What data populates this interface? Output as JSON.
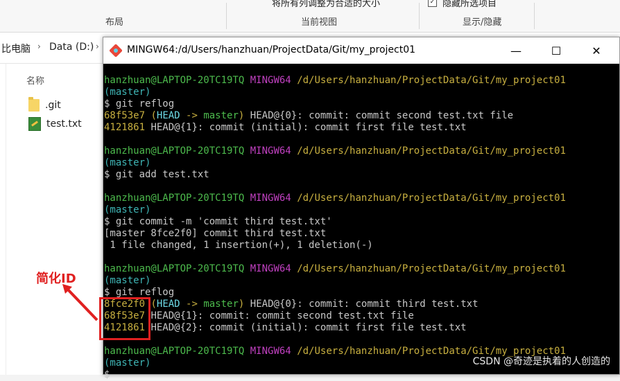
{
  "explorer": {
    "ribbon_clipped": [
      "将所有列调整为合适的大小",
      "隐藏所选项目"
    ],
    "groups": [
      "布局",
      "当前视图",
      "显示/隐藏"
    ],
    "breadcrumb": [
      "比电脑",
      "Data (D:)"
    ],
    "column_header": "名称",
    "files": [
      {
        "name": ".git",
        "icon": "folder-icon"
      },
      {
        "name": "test.txt",
        "icon": "text-file-icon"
      }
    ]
  },
  "terminal": {
    "title": "MINGW64:/d/Users/hanzhuan/ProjectData/Git/my_project01",
    "buttons": {
      "minimize": "—",
      "maximize": "☐",
      "close": "✕"
    },
    "prompt": {
      "user": "hanzhuan@LAPTOP-20TC19TQ",
      "env": "MINGW64",
      "path": "/d/Users/hanzhuan/ProjectData/Git/my_project01",
      "branch": "(master)"
    },
    "blocks": [
      {
        "command": "$ git reflog",
        "output": [
          {
            "hash": "68f53e7",
            "decor": "(HEAD -> master)",
            "text": "HEAD@{0}: commit: commit second test.txt file"
          },
          {
            "hash": "4121861",
            "text": "HEAD@{1}: commit (initial): commit first file test.txt"
          }
        ]
      },
      {
        "command": "$ git add test.txt",
        "output": []
      },
      {
        "command": "$ git commit -m 'commit third test.txt'",
        "output": [
          {
            "text": "[master 8fce2f0] commit third test.txt"
          },
          {
            "text": " 1 file changed, 1 insertion(+), 1 deletion(-)"
          }
        ]
      },
      {
        "command": "$ git reflog",
        "output": [
          {
            "hash": "8fce2f0",
            "decor": "(HEAD -> master)",
            "text": "HEAD@{0}: commit: commit third test.txt"
          },
          {
            "hash": "68f53e7",
            "text": "HEAD@{1}: commit: commit second test.txt file"
          },
          {
            "hash": "4121861",
            "text": "HEAD@{2}: commit (initial): commit first file test.txt"
          }
        ]
      },
      {
        "command": "$",
        "output": []
      }
    ]
  },
  "annotation": {
    "label": "简化ID",
    "color": "#e02020"
  },
  "watermark": "CSDN @奇迹是执着的人创造的"
}
